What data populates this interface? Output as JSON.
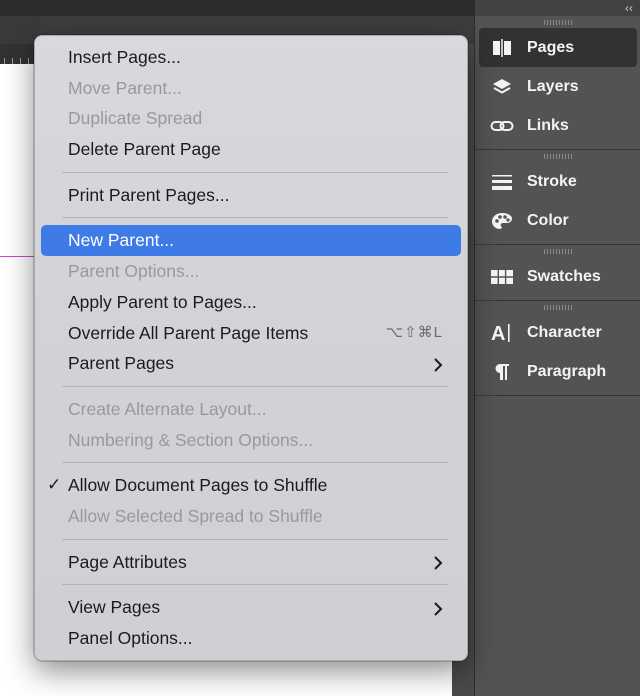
{
  "dock": {
    "collapse_glyph": "‹‹",
    "groups": [
      [
        {
          "label": "Pages",
          "icon": "pages-icon",
          "active": true
        },
        {
          "label": "Layers",
          "icon": "layers-icon"
        },
        {
          "label": "Links",
          "icon": "links-icon"
        }
      ],
      [
        {
          "label": "Stroke",
          "icon": "stroke-icon"
        },
        {
          "label": "Color",
          "icon": "color-palette-icon"
        }
      ],
      [
        {
          "label": "Swatches",
          "icon": "swatches-icon"
        }
      ],
      [
        {
          "label": "Character",
          "icon": "character-icon"
        },
        {
          "label": "Paragraph",
          "icon": "paragraph-icon"
        }
      ]
    ]
  },
  "menu": {
    "items": [
      {
        "label": "Insert Pages...",
        "state": "enabled"
      },
      {
        "label": "Move Parent...",
        "state": "disabled"
      },
      {
        "label": "Duplicate Spread",
        "state": "disabled"
      },
      {
        "label": "Delete Parent Page",
        "state": "enabled"
      },
      {
        "type": "separator"
      },
      {
        "label": "Print Parent Pages...",
        "state": "enabled"
      },
      {
        "type": "separator"
      },
      {
        "label": "New Parent...",
        "state": "highlighted"
      },
      {
        "label": "Parent Options...",
        "state": "disabled"
      },
      {
        "label": "Apply Parent to Pages...",
        "state": "enabled"
      },
      {
        "label": "Override All Parent Page Items",
        "state": "enabled",
        "shortcut": "⌥⇧⌘L"
      },
      {
        "label": "Parent Pages",
        "state": "enabled",
        "submenu": true
      },
      {
        "type": "separator"
      },
      {
        "label": "Create Alternate Layout...",
        "state": "disabled"
      },
      {
        "label": "Numbering & Section Options...",
        "state": "disabled"
      },
      {
        "type": "separator"
      },
      {
        "label": "Allow Document Pages to Shuffle",
        "state": "enabled",
        "checked": true
      },
      {
        "label": "Allow Selected Spread to Shuffle",
        "state": "disabled"
      },
      {
        "type": "separator"
      },
      {
        "label": "Page Attributes",
        "state": "enabled",
        "submenu": true
      },
      {
        "type": "separator"
      },
      {
        "label": "View Pages",
        "state": "enabled",
        "submenu": true
      },
      {
        "label": "Panel Options...",
        "state": "enabled"
      }
    ]
  },
  "colors": {
    "highlight": "#3f7be6",
    "disabled_text": "#98999c",
    "dock_background": "#535353"
  }
}
